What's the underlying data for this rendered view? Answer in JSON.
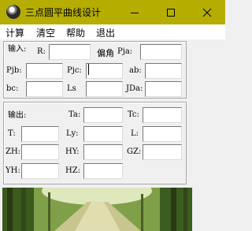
{
  "window": {
    "title": "三点圆平曲线设计",
    "icon": "circle-app-icon",
    "controls": [
      "minimize",
      "maximize",
      "close"
    ]
  },
  "menu": {
    "items": [
      "计算",
      "清空",
      "帮助",
      "退出"
    ]
  },
  "input_group": {
    "caption": "输入:",
    "labels": {
      "R": "R:",
      "deflection": "偏角",
      "Pja": "Pja:",
      "Pjb": "Pjb:",
      "Pjc": "Pjc:",
      "ab": "ab:",
      "bc": "bc:",
      "Ls": "Ls",
      "JDa": "JDa:"
    },
    "values": {
      "R": "",
      "Pja": "",
      "Pjb": "",
      "Pjc": "",
      "ab": "",
      "bc": "",
      "Ls": "",
      "JDa": ""
    }
  },
  "output_group": {
    "caption": "输出:",
    "labels": {
      "Ta": "Ta:",
      "Tc": "Tc:",
      "T": "T:",
      "Ly": "Ly:",
      "L": "L:",
      "ZH": "ZH:",
      "HY": "HY:",
      "GZ": "GZ:",
      "YH": "YH:",
      "HZ": "HZ:"
    },
    "values": {
      "Ta": "",
      "Tc": "",
      "T": "",
      "Ly": "",
      "L": "",
      "ZH": "",
      "HY": "",
      "GZ": "",
      "YH": "",
      "HZ": ""
    }
  },
  "colors": {
    "titlebar": "#b5ae00",
    "menubar": "#ffffff",
    "client": "#f0f0f0"
  }
}
